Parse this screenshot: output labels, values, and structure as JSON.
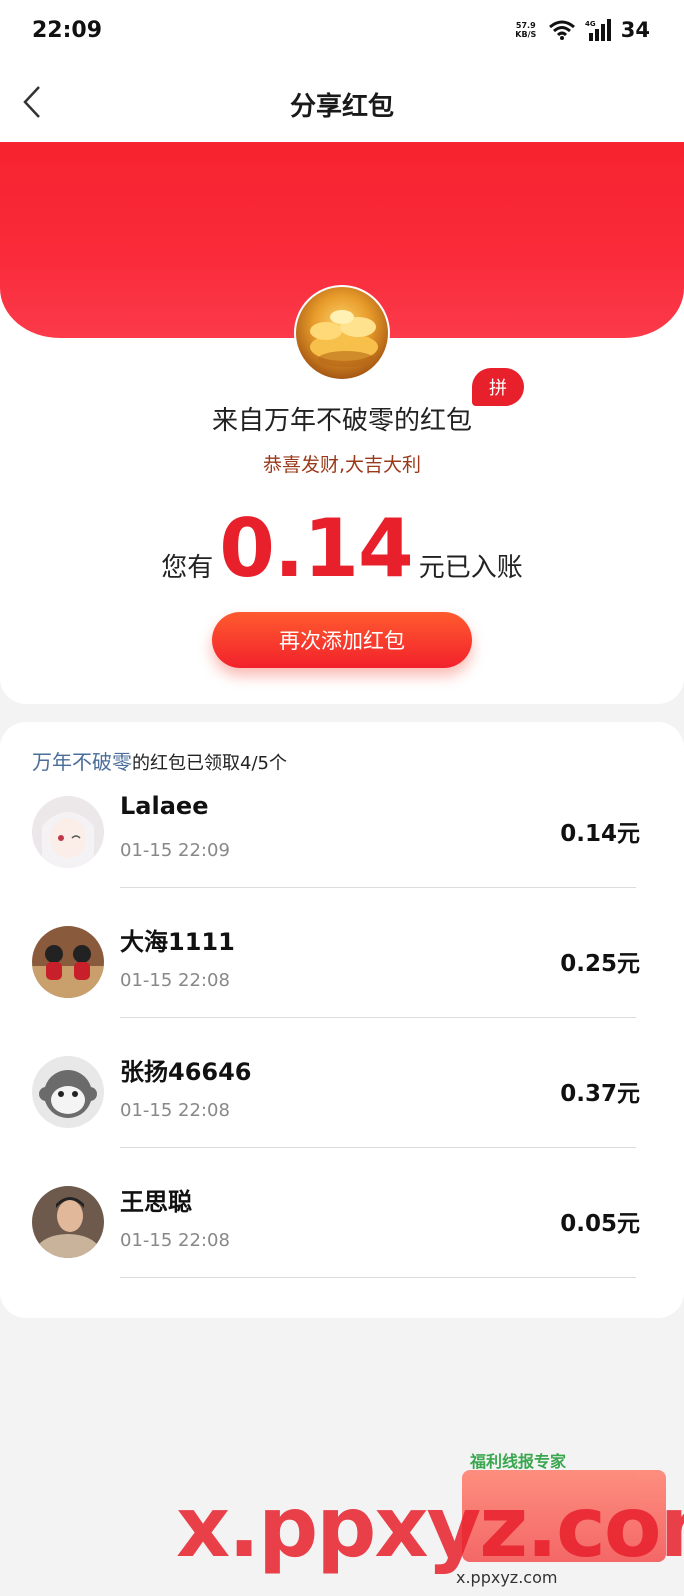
{
  "status_bar": {
    "time": "22:09",
    "net_speed_top": "57.9",
    "net_speed_bottom": "KB/S",
    "signal_label": "4G",
    "battery": "34"
  },
  "nav": {
    "title": "分享红包"
  },
  "packet": {
    "badge": "拼",
    "from": "来自万年不破零的红包",
    "blessing": "恭喜发财,大吉大利",
    "amount_prefix": "您有",
    "amount": "0.14",
    "amount_suffix": "元已入账",
    "add_button": "再次添加红包"
  },
  "list": {
    "sender_name": "万年不破零",
    "summary_suffix": "的红包已领取4/5个",
    "rows": [
      {
        "name": "Lalaee",
        "time": "01-15 22:09",
        "amount": "0.14元"
      },
      {
        "name": "大海1111",
        "time": "01-15 22:08",
        "amount": "0.25元"
      },
      {
        "name": "张扬46646",
        "time": "01-15 22:08",
        "amount": "0.37元"
      },
      {
        "name": "王思聪",
        "time": "01-15 22:08",
        "amount": "0.05元"
      }
    ]
  },
  "watermark": {
    "big": "x.ppxyz.com",
    "small": "x.ppxyz.com",
    "app_label": "福利线报专家"
  },
  "colors": {
    "accent_red": "#e8202c",
    "header_red": "#f7232f",
    "name_blue": "#4a6d9a",
    "blessing_brown": "#9a3a1a"
  }
}
